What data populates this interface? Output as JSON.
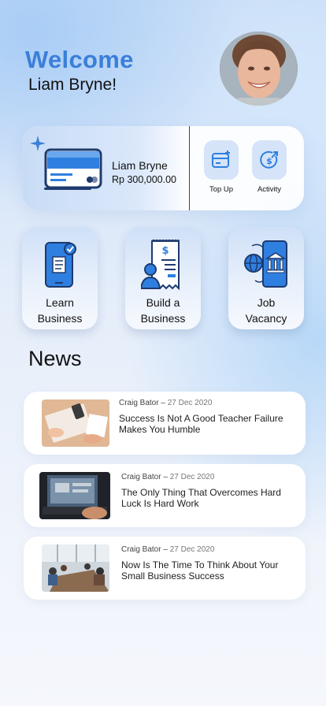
{
  "header": {
    "greeting": "Welcome",
    "user_name": "Liam Bryne!"
  },
  "wallet": {
    "holder": "Liam Bryne",
    "balance": "Rp 300,000.00",
    "actions": [
      {
        "label": "Top Up",
        "icon": "top-up-icon"
      },
      {
        "label": "Activity",
        "icon": "activity-icon"
      }
    ]
  },
  "categories": [
    {
      "line1": "Learn",
      "line2": "Business",
      "icon": "learn-business-icon"
    },
    {
      "line1": "Build a",
      "line2": "Business",
      "icon": "build-business-icon"
    },
    {
      "line1": "Job",
      "line2": "Vacancy",
      "icon": "job-vacancy-icon"
    }
  ],
  "news": {
    "title": "News",
    "items": [
      {
        "author": "Craig Bator",
        "date": "27 Dec 2020",
        "headline": "Success Is Not A Good Teacher Failure Makes You Humble"
      },
      {
        "author": "Craig Bator",
        "date": "27 Dec 2020",
        "headline": "The Only Thing That Overcomes Hard Luck Is Hard Work"
      },
      {
        "author": "Craig Bator",
        "date": "27 Dec 2020",
        "headline": "Now Is The Time To Think About Your Small Business Success"
      }
    ]
  },
  "colors": {
    "accent": "#3a7fd9",
    "icon_blue": "#2f7fe0",
    "icon_navy": "#1e3a6e",
    "tile_bg": "#cfe0f7"
  }
}
